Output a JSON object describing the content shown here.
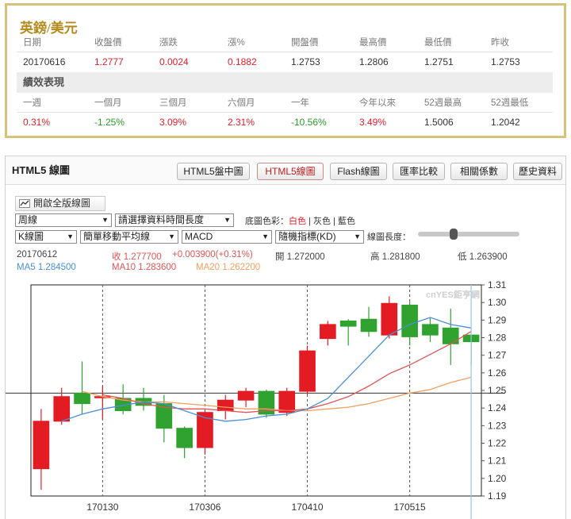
{
  "quote": {
    "title": "英鎊/美元",
    "headers": [
      "日期",
      "收盤價",
      "漲跌",
      "漲%",
      "開盤價",
      "最高價",
      "最低價",
      "昨收"
    ],
    "values": [
      "20170616",
      "1.2777",
      "0.0024",
      "0.1882",
      "1.2753",
      "1.2806",
      "1.2751",
      "1.2753"
    ],
    "perf_title": "績效表現",
    "perf_headers": [
      "一週",
      "一個月",
      "三個月",
      "六個月",
      "一年",
      "今年以來",
      "52週最高",
      "52週最低"
    ],
    "perf_values": [
      "0.31%",
      "-1.25%",
      "3.09%",
      "2.31%",
      "-10.56%",
      "3.49%",
      "1.5006",
      "1.2042"
    ]
  },
  "chart_panel": {
    "title": "HTML5 線圖",
    "tabs": [
      "HTML5盤中圖",
      "HTML5線圖",
      "Flash線圖",
      "匯率比較",
      "相關係數",
      "歷史資料"
    ],
    "active_tab": "HTML5線圖",
    "full_view_button": "開啟全版線圖",
    "period_select": "周線",
    "range_select": "請選擇資料時間長度",
    "bg_color_label": "底圖色彩：",
    "bg_options": [
      "白色",
      "灰色",
      "藍色"
    ],
    "chart_type_select": "K線圖",
    "ma_select": "簡單移動平均線",
    "indicator1_select": "MACD",
    "indicator2_select": "隨機指標(KD)",
    "height_label": "線圖長度：",
    "info": {
      "date": "20170612",
      "close": "收 1.277700",
      "change": "+0.003900(+0.31%)",
      "open": "開 1.272000",
      "high": "高 1.281800",
      "low": "低 1.263900",
      "ma5": "MA5 1.284500",
      "ma10": "MA10 1.283600",
      "ma20": "MA20 1.262200"
    },
    "watermark": "cnYES鉅亨網"
  },
  "colors": {
    "up": "#e31b23",
    "down": "#2fa22f",
    "ma5": "#4a8fd6",
    "ma10": "#e05555",
    "ma20": "#f0a060",
    "accent_gold": "#d7c27a"
  },
  "chart_data": {
    "type": "candlestick",
    "ylim": [
      1.19,
      1.31
    ],
    "yticks": [
      1.31,
      1.3,
      1.29,
      1.28,
      1.27,
      1.26,
      1.25,
      1.24,
      1.23,
      1.22,
      1.21,
      1.2,
      1.19
    ],
    "xtick_labels": [
      "170130",
      "170306",
      "170410",
      "170515"
    ],
    "xtick_positions": [
      3.5,
      8.5,
      13.5,
      18.5
    ],
    "candles": [
      {
        "o": 1.2055,
        "h": 1.2395,
        "l": 1.1935,
        "c": 1.2325
      },
      {
        "o": 1.2325,
        "h": 1.2515,
        "l": 1.2305,
        "c": 1.2465
      },
      {
        "o": 1.2485,
        "h": 1.2665,
        "l": 1.2365,
        "c": 1.2425
      },
      {
        "o": 1.2465,
        "h": 1.2525,
        "l": 1.2335,
        "c": 1.2465
      },
      {
        "o": 1.2455,
        "h": 1.2535,
        "l": 1.2365,
        "c": 1.2385
      },
      {
        "o": 1.2455,
        "h": 1.2515,
        "l": 1.2385,
        "c": 1.2415
      },
      {
        "o": 1.2425,
        "h": 1.2475,
        "l": 1.2205,
        "c": 1.2285
      },
      {
        "o": 1.2285,
        "h": 1.2295,
        "l": 1.2115,
        "c": 1.2175
      },
      {
        "o": 1.2175,
        "h": 1.2385,
        "l": 1.2135,
        "c": 1.2375
      },
      {
        "o": 1.2385,
        "h": 1.2475,
        "l": 1.2335,
        "c": 1.2445
      },
      {
        "o": 1.2445,
        "h": 1.2515,
        "l": 1.2405,
        "c": 1.2495
      },
      {
        "o": 1.2495,
        "h": 1.2505,
        "l": 1.2345,
        "c": 1.2365
      },
      {
        "o": 1.2375,
        "h": 1.2515,
        "l": 1.2355,
        "c": 1.2495
      },
      {
        "o": 1.2495,
        "h": 1.2755,
        "l": 1.2475,
        "c": 1.2725
      },
      {
        "o": 1.2795,
        "h": 1.2895,
        "l": 1.2755,
        "c": 1.2875
      },
      {
        "o": 1.2895,
        "h": 1.2905,
        "l": 1.2755,
        "c": 1.2865
      },
      {
        "o": 1.2905,
        "h": 1.2975,
        "l": 1.2805,
        "c": 1.2835
      },
      {
        "o": 1.2815,
        "h": 1.3035,
        "l": 1.2795,
        "c": 1.2995
      },
      {
        "o": 1.2985,
        "h": 1.3005,
        "l": 1.2755,
        "c": 1.2805
      },
      {
        "o": 1.2875,
        "h": 1.2915,
        "l": 1.2775,
        "c": 1.2815
      },
      {
        "o": 1.2855,
        "h": 1.2965,
        "l": 1.2645,
        "c": 1.2765
      },
      {
        "o": 1.2815,
        "h": 1.2815,
        "l": 1.2645,
        "c": 1.2777
      }
    ],
    "ma5": [
      null,
      1.2325,
      1.2365,
      1.2395,
      1.2415,
      1.2435,
      1.2425,
      1.2385,
      1.2345,
      1.2325,
      1.2335,
      1.2355,
      1.2365,
      1.2395,
      1.2455,
      1.2575,
      1.2695,
      1.2815,
      1.2875,
      1.2915,
      1.2875,
      1.2855
    ],
    "ma10": [
      null,
      null,
      null,
      1.2475,
      1.2455,
      1.2425,
      1.2405,
      1.2395,
      1.2395,
      1.2385,
      1.2375,
      1.2385,
      1.2385,
      1.2395,
      1.2425,
      1.2465,
      1.2525,
      1.2595,
      1.2645,
      1.2705,
      1.2765,
      1.2835
    ],
    "ma20": [
      null,
      null,
      1.2495,
      1.2465,
      1.2445,
      1.2435,
      1.2435,
      1.2425,
      1.2415,
      1.2405,
      1.2395,
      1.2395,
      1.2385,
      1.2385,
      1.2395,
      1.2405,
      1.2425,
      1.2455,
      1.2485,
      1.2505,
      1.2545,
      1.2575
    ],
    "hline": 1.2485,
    "cursor_index": 21
  }
}
